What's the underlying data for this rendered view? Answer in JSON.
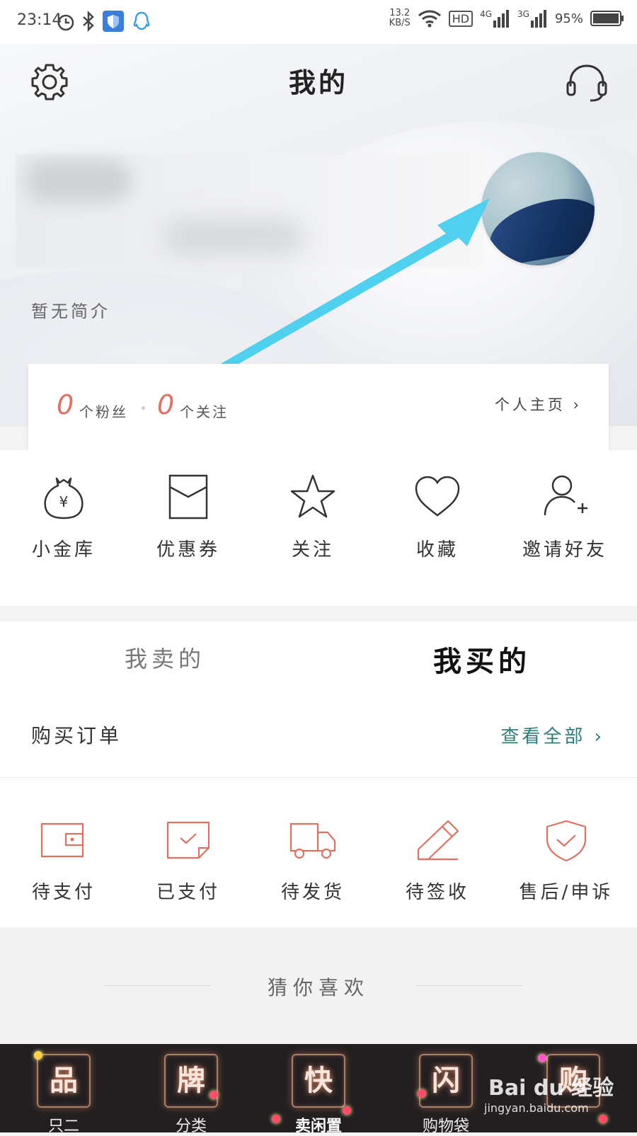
{
  "status_bar": {
    "time": "23:14",
    "net_speed_value": "13.2",
    "net_speed_unit": "KB/S",
    "hd": "HD",
    "net_4g": "4G",
    "net_3g": "3G",
    "battery": "95%"
  },
  "header": {
    "title": "我的"
  },
  "profile": {
    "bio": "暂无简介"
  },
  "stats": {
    "fans_count": "0",
    "fans_label": "个粉丝",
    "follow_count": "0",
    "follow_label": "个关注",
    "homepage_label": "个人主页 ›"
  },
  "quick_actions": [
    {
      "label": "小金库",
      "icon": "money-bag-icon"
    },
    {
      "label": "优惠券",
      "icon": "coupon-icon"
    },
    {
      "label": "关注",
      "icon": "star-icon"
    },
    {
      "label": "收藏",
      "icon": "heart-icon"
    },
    {
      "label": "邀请好友",
      "icon": "add-friend-icon"
    }
  ],
  "tabs": {
    "sell": "我卖的",
    "buy": "我买的"
  },
  "orders": {
    "title": "购买订单",
    "view_all": "查看全部 ›",
    "items": [
      {
        "label": "待支付",
        "icon": "wallet-icon"
      },
      {
        "label": "已支付",
        "icon": "paid-icon"
      },
      {
        "label": "待发货",
        "icon": "truck-icon"
      },
      {
        "label": "待签收",
        "icon": "pencil-icon"
      },
      {
        "label": "售后/申诉",
        "icon": "shield-check-icon"
      }
    ]
  },
  "guess": {
    "title": "猜你喜欢"
  },
  "bottom_nav": [
    {
      "glyph": "品",
      "label": "只二"
    },
    {
      "glyph": "牌",
      "label": "分类"
    },
    {
      "glyph": "快",
      "label": "卖闲置"
    },
    {
      "glyph": "闪",
      "label": "购物袋"
    },
    {
      "glyph": "购",
      "label": ""
    }
  ],
  "watermark": {
    "brand": "Bai du 经验",
    "url": "jingyan.baidu.com"
  },
  "colors": {
    "accent_red": "#e07060",
    "link_teal": "#2e7f7a",
    "nav_bg": "#231f20",
    "arrow": "#4fd0ef"
  }
}
